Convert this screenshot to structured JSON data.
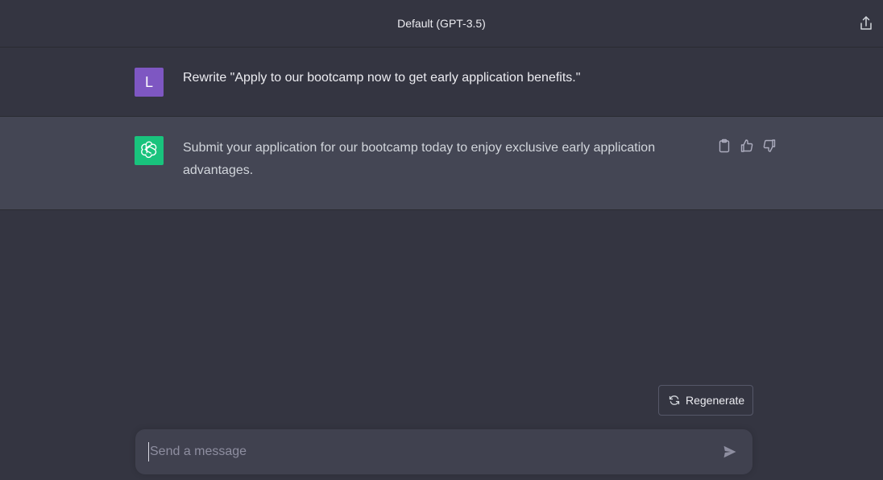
{
  "header": {
    "title": "Default (GPT-3.5)",
    "share_icon": "share-icon"
  },
  "messages": [
    {
      "role": "user",
      "avatar_letter": "L",
      "avatar_color": "#7e57c2",
      "text": "Rewrite \"Apply to our bootcamp now to get early application benefits.\""
    },
    {
      "role": "assistant",
      "avatar_icon": "openai-logo-icon",
      "avatar_color": "#19c37d",
      "text": "Submit your application for our bootcamp today to enjoy exclusive early application advantages.",
      "actions": [
        "copy-icon",
        "thumbs-up-icon",
        "thumbs-down-icon"
      ]
    }
  ],
  "regenerate": {
    "label": "Regenerate",
    "icon": "refresh-icon"
  },
  "composer": {
    "placeholder": "Send a message",
    "value": "",
    "send_icon": "send-icon"
  },
  "colors": {
    "background": "#343541",
    "assistant_row": "#444654",
    "composer": "#40414f",
    "accent_green": "#19c37d"
  }
}
